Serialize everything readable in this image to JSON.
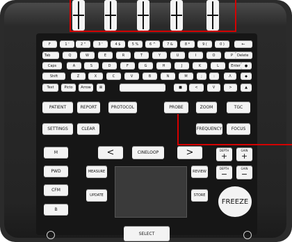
{
  "knobs": [
    "knob-1",
    "knob-2",
    "knob-3",
    "knob-4",
    "knob-5"
  ],
  "rows": {
    "numbers": [
      {
        "id": "f",
        "label": "F"
      },
      {
        "id": "1",
        "label": "1 '"
      },
      {
        "id": "2",
        "label": "2 \""
      },
      {
        "id": "3",
        "label": "3 '"
      },
      {
        "id": "4",
        "label": "4 $"
      },
      {
        "id": "5",
        "label": "5 %"
      },
      {
        "id": "6",
        "label": "6 ^"
      },
      {
        "id": "7",
        "label": "7 &"
      },
      {
        "id": "8",
        "label": "8 *"
      },
      {
        "id": "9",
        "label": "9 ("
      },
      {
        "id": "0",
        "label": "0 )"
      },
      {
        "id": "backspace",
        "label": "←"
      }
    ],
    "qwerty": [
      {
        "id": "tab",
        "label": "Tab"
      },
      {
        "id": "q",
        "label": "Q"
      },
      {
        "id": "w",
        "label": "W"
      },
      {
        "id": "e",
        "label": "E"
      },
      {
        "id": "r",
        "label": "R"
      },
      {
        "id": "t",
        "label": "T"
      },
      {
        "id": "y",
        "label": "Y"
      },
      {
        "id": "u",
        "label": "U"
      },
      {
        "id": "i",
        "label": "I"
      },
      {
        "id": "o",
        "label": "O"
      },
      {
        "id": "p",
        "label": "P"
      },
      {
        "id": "delete",
        "label": "Delete"
      }
    ],
    "asdf": [
      {
        "id": "caps",
        "label": "Caps"
      },
      {
        "id": "a",
        "label": "A"
      },
      {
        "id": "s",
        "label": "S"
      },
      {
        "id": "d",
        "label": "D"
      },
      {
        "id": "f2",
        "label": "F"
      },
      {
        "id": "g",
        "label": "G"
      },
      {
        "id": "h",
        "label": "H"
      },
      {
        "id": "j",
        "label": "J"
      },
      {
        "id": "k",
        "label": "K"
      },
      {
        "id": "l",
        "label": "L"
      },
      {
        "id": "enter",
        "label": "Enter"
      },
      {
        "id": "dot",
        "label": "●"
      }
    ],
    "zxcv": [
      {
        "id": "shift",
        "label": "Shift"
      },
      {
        "id": "z",
        "label": "Z"
      },
      {
        "id": "x",
        "label": "X"
      },
      {
        "id": "c",
        "label": "C"
      },
      {
        "id": "v",
        "label": "V"
      },
      {
        "id": "b",
        "label": "B"
      },
      {
        "id": "n",
        "label": "N"
      },
      {
        "id": "m",
        "label": "M"
      },
      {
        "id": "semicolon",
        "label": ";"
      },
      {
        "id": "colon",
        "label": ":"
      },
      {
        "id": "up",
        "label": "Λ"
      },
      {
        "id": "diamond",
        "label": "◆"
      }
    ],
    "bottom": [
      {
        "id": "text",
        "label": "Text"
      },
      {
        "id": "picto",
        "label": "Picto"
      },
      {
        "id": "arrow",
        "label": "Arrow"
      },
      {
        "id": "x-box",
        "label": "⊠"
      },
      {
        "id": "space",
        "label": ""
      },
      {
        "id": "square",
        "label": "■"
      },
      {
        "id": "lt",
        "label": "<"
      },
      {
        "id": "v-down",
        "label": "V"
      },
      {
        "id": "gt",
        "label": ">"
      },
      {
        "id": "tri-up",
        "label": "▲"
      }
    ]
  },
  "functions": {
    "patient": "PATIENT",
    "report": "REPORT",
    "protocol": "PROTOCOL",
    "probe": "PROBE",
    "zoom": "ZOOM",
    "tgc": "TGC",
    "settings": "SETTINGS",
    "clear": "CLEAR",
    "frequency": "FREQUENCY",
    "focus": "FOCUS"
  },
  "modes": {
    "m": "M",
    "pwd": "PWD",
    "cfm": "CFM",
    "b": "B"
  },
  "nav": {
    "prev": "<",
    "cineloop": "CINELOOP",
    "next": ">"
  },
  "side": {
    "measure": "MEASURE",
    "update": "UPDATE",
    "review": "REVIEW",
    "store": "STORE"
  },
  "depth_gain": {
    "depth": "DEPTH",
    "gain": "GAIN",
    "plus": "+",
    "minus": "−"
  },
  "freeze": "FREEZE",
  "select": "SELECT",
  "highlight_color": "#d40000"
}
